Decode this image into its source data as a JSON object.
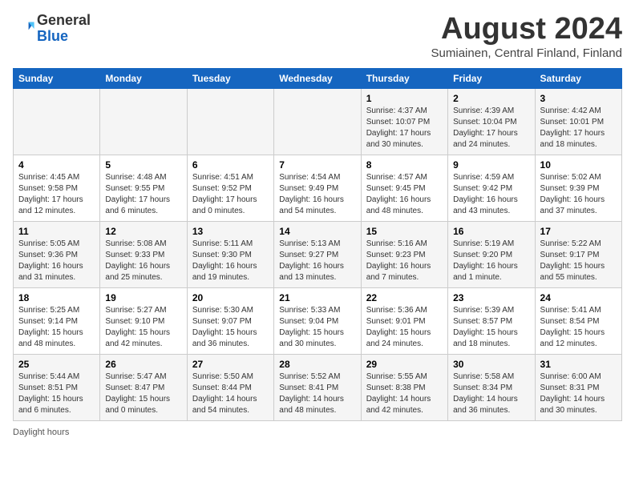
{
  "header": {
    "logo_general": "General",
    "logo_blue": "Blue",
    "month_year": "August 2024",
    "location": "Sumiainen, Central Finland, Finland"
  },
  "footer": {
    "daylight_label": "Daylight hours"
  },
  "weekdays": [
    "Sunday",
    "Monday",
    "Tuesday",
    "Wednesday",
    "Thursday",
    "Friday",
    "Saturday"
  ],
  "weeks": [
    [
      {
        "day": "",
        "info": ""
      },
      {
        "day": "",
        "info": ""
      },
      {
        "day": "",
        "info": ""
      },
      {
        "day": "",
        "info": ""
      },
      {
        "day": "1",
        "info": "Sunrise: 4:37 AM\nSunset: 10:07 PM\nDaylight: 17 hours\nand 30 minutes."
      },
      {
        "day": "2",
        "info": "Sunrise: 4:39 AM\nSunset: 10:04 PM\nDaylight: 17 hours\nand 24 minutes."
      },
      {
        "day": "3",
        "info": "Sunrise: 4:42 AM\nSunset: 10:01 PM\nDaylight: 17 hours\nand 18 minutes."
      }
    ],
    [
      {
        "day": "4",
        "info": "Sunrise: 4:45 AM\nSunset: 9:58 PM\nDaylight: 17 hours\nand 12 minutes."
      },
      {
        "day": "5",
        "info": "Sunrise: 4:48 AM\nSunset: 9:55 PM\nDaylight: 17 hours\nand 6 minutes."
      },
      {
        "day": "6",
        "info": "Sunrise: 4:51 AM\nSunset: 9:52 PM\nDaylight: 17 hours\nand 0 minutes."
      },
      {
        "day": "7",
        "info": "Sunrise: 4:54 AM\nSunset: 9:49 PM\nDaylight: 16 hours\nand 54 minutes."
      },
      {
        "day": "8",
        "info": "Sunrise: 4:57 AM\nSunset: 9:45 PM\nDaylight: 16 hours\nand 48 minutes."
      },
      {
        "day": "9",
        "info": "Sunrise: 4:59 AM\nSunset: 9:42 PM\nDaylight: 16 hours\nand 43 minutes."
      },
      {
        "day": "10",
        "info": "Sunrise: 5:02 AM\nSunset: 9:39 PM\nDaylight: 16 hours\nand 37 minutes."
      }
    ],
    [
      {
        "day": "11",
        "info": "Sunrise: 5:05 AM\nSunset: 9:36 PM\nDaylight: 16 hours\nand 31 minutes."
      },
      {
        "day": "12",
        "info": "Sunrise: 5:08 AM\nSunset: 9:33 PM\nDaylight: 16 hours\nand 25 minutes."
      },
      {
        "day": "13",
        "info": "Sunrise: 5:11 AM\nSunset: 9:30 PM\nDaylight: 16 hours\nand 19 minutes."
      },
      {
        "day": "14",
        "info": "Sunrise: 5:13 AM\nSunset: 9:27 PM\nDaylight: 16 hours\nand 13 minutes."
      },
      {
        "day": "15",
        "info": "Sunrise: 5:16 AM\nSunset: 9:23 PM\nDaylight: 16 hours\nand 7 minutes."
      },
      {
        "day": "16",
        "info": "Sunrise: 5:19 AM\nSunset: 9:20 PM\nDaylight: 16 hours\nand 1 minute."
      },
      {
        "day": "17",
        "info": "Sunrise: 5:22 AM\nSunset: 9:17 PM\nDaylight: 15 hours\nand 55 minutes."
      }
    ],
    [
      {
        "day": "18",
        "info": "Sunrise: 5:25 AM\nSunset: 9:14 PM\nDaylight: 15 hours\nand 48 minutes."
      },
      {
        "day": "19",
        "info": "Sunrise: 5:27 AM\nSunset: 9:10 PM\nDaylight: 15 hours\nand 42 minutes."
      },
      {
        "day": "20",
        "info": "Sunrise: 5:30 AM\nSunset: 9:07 PM\nDaylight: 15 hours\nand 36 minutes."
      },
      {
        "day": "21",
        "info": "Sunrise: 5:33 AM\nSunset: 9:04 PM\nDaylight: 15 hours\nand 30 minutes."
      },
      {
        "day": "22",
        "info": "Sunrise: 5:36 AM\nSunset: 9:01 PM\nDaylight: 15 hours\nand 24 minutes."
      },
      {
        "day": "23",
        "info": "Sunrise: 5:39 AM\nSunset: 8:57 PM\nDaylight: 15 hours\nand 18 minutes."
      },
      {
        "day": "24",
        "info": "Sunrise: 5:41 AM\nSunset: 8:54 PM\nDaylight: 15 hours\nand 12 minutes."
      }
    ],
    [
      {
        "day": "25",
        "info": "Sunrise: 5:44 AM\nSunset: 8:51 PM\nDaylight: 15 hours\nand 6 minutes."
      },
      {
        "day": "26",
        "info": "Sunrise: 5:47 AM\nSunset: 8:47 PM\nDaylight: 15 hours\nand 0 minutes."
      },
      {
        "day": "27",
        "info": "Sunrise: 5:50 AM\nSunset: 8:44 PM\nDaylight: 14 hours\nand 54 minutes."
      },
      {
        "day": "28",
        "info": "Sunrise: 5:52 AM\nSunset: 8:41 PM\nDaylight: 14 hours\nand 48 minutes."
      },
      {
        "day": "29",
        "info": "Sunrise: 5:55 AM\nSunset: 8:38 PM\nDaylight: 14 hours\nand 42 minutes."
      },
      {
        "day": "30",
        "info": "Sunrise: 5:58 AM\nSunset: 8:34 PM\nDaylight: 14 hours\nand 36 minutes."
      },
      {
        "day": "31",
        "info": "Sunrise: 6:00 AM\nSunset: 8:31 PM\nDaylight: 14 hours\nand 30 minutes."
      }
    ]
  ]
}
